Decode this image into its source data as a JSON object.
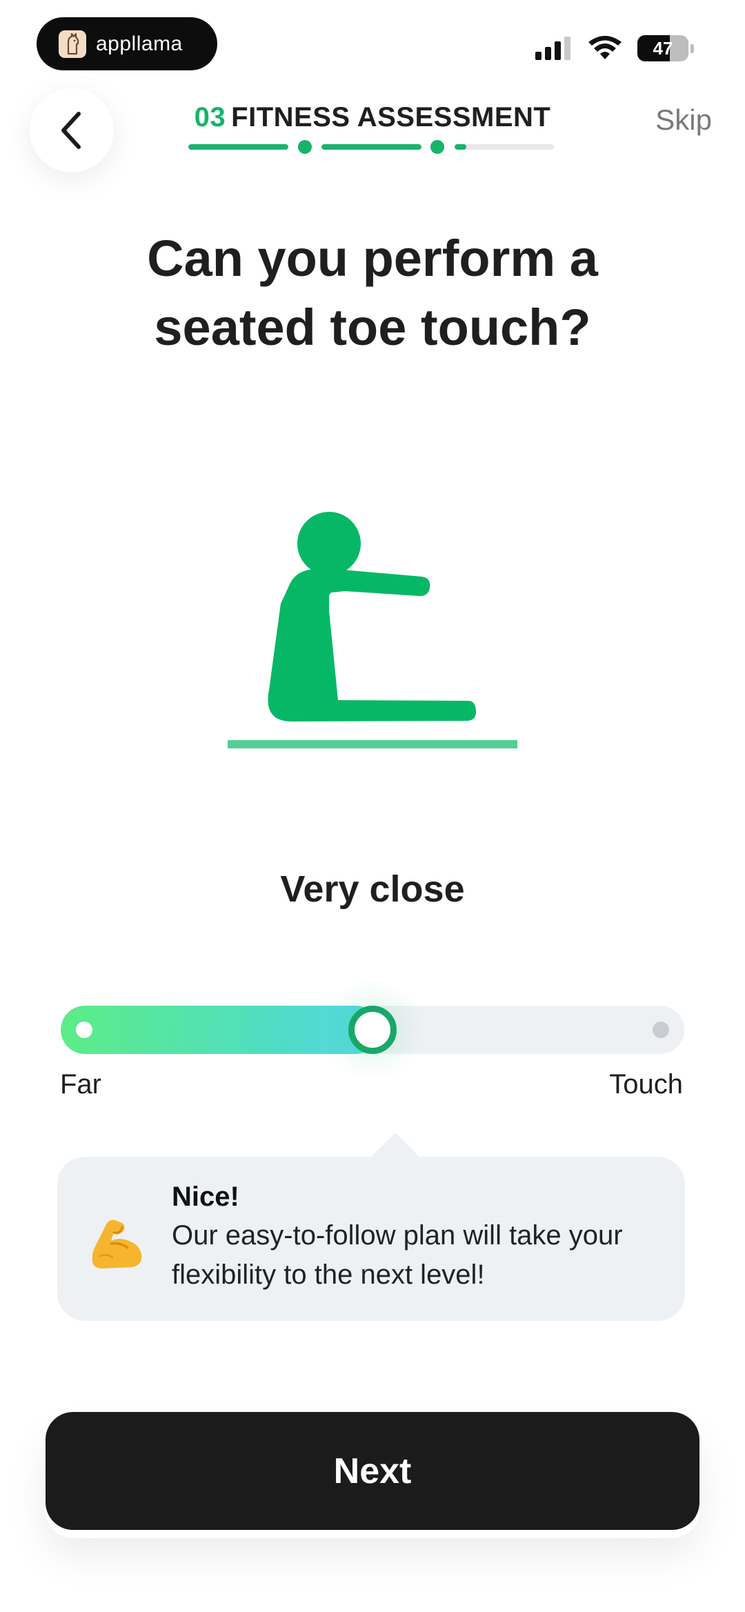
{
  "status_bar": {
    "app_pill_label": "appllama",
    "logo_icon": "llama-logo-icon",
    "battery": "47"
  },
  "header": {
    "step_number": "03",
    "step_title": "FITNESS ASSESSMENT",
    "skip_label": "Skip",
    "back_icon": "chevron-left-icon",
    "progress": {
      "segments_fill": [
        1.0,
        1.0,
        0.12
      ],
      "accent_color": "#18b36b"
    }
  },
  "question": {
    "line1": "Can you perform a",
    "line2": "seated toe touch?"
  },
  "illustration": {
    "icon": "seated-toe-touch-figure",
    "color": "#06b865"
  },
  "slider": {
    "current_label": "Very close",
    "min_label": "Far",
    "max_label": "Touch",
    "value": 0.5
  },
  "feedback": {
    "emoji_icon": "flexed-biceps-icon",
    "title": "Nice!",
    "body": "Our easy-to-follow plan will take your flexibility to the next level!"
  },
  "footer": {
    "next_label": "Next"
  }
}
